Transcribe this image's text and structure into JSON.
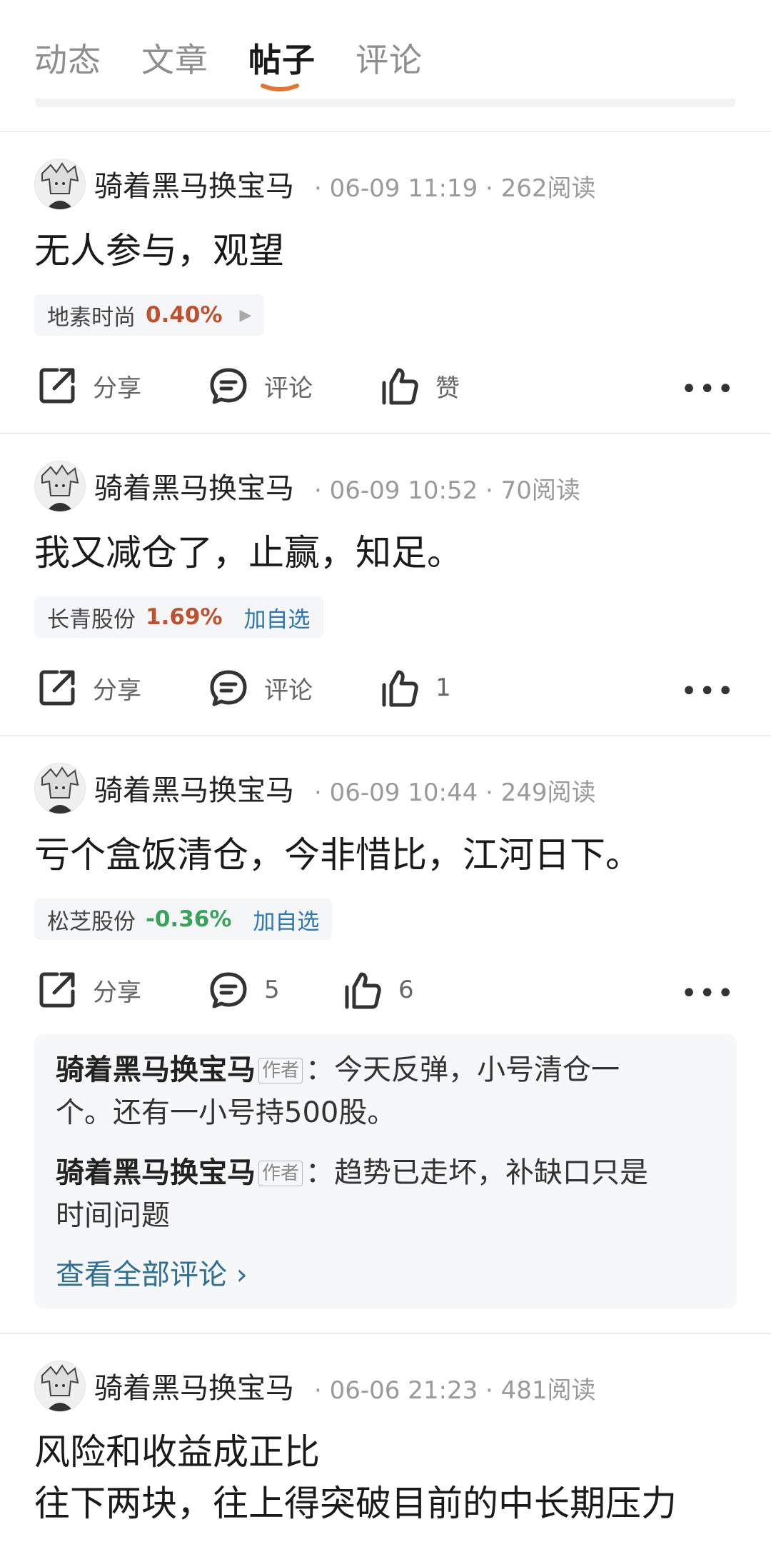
{
  "tabs": [
    "动态",
    "文章",
    "帖子",
    "评论"
  ],
  "active_tab": "帖子",
  "colors": {
    "up": "#c0512f",
    "down": "#3aa35b",
    "accent": "#e8742f",
    "link": "#2f77b3"
  },
  "posts": [
    {
      "author": "骑着黑马换宝马",
      "meta": "· 06-09 11:19 · 262阅读",
      "content": "无人参与，观望",
      "stock": {
        "name": "地素时尚",
        "pct": "0.40%",
        "action": ""
      },
      "share": "分享",
      "comment": "评论",
      "like": "赞"
    },
    {
      "author": "骑着黑马换宝马",
      "meta": "· 06-09 10:52 · 70阅读",
      "content": "我又减仓了，止赢，知足。",
      "stock": {
        "name": "长青股份",
        "pct": "1.69%",
        "action": "加自选"
      },
      "share": "分享",
      "comment": "评论",
      "like": "1"
    },
    {
      "author": "骑着黑马换宝马",
      "meta": "· 06-09 10:44 · 249阅读",
      "content": "亏个盒饭清仓，今非惜比，江河日下。",
      "stock": {
        "name": "松芝股份",
        "pct": "-0.36%",
        "action": "加自选"
      },
      "share": "分享",
      "comment": "5",
      "like": "6",
      "comments": [
        {
          "author": "骑着黑马换宝马",
          "tag": "作者",
          "text1": "：今天反弹，小号清仓一",
          "text2": "个。还有一小号持500股。"
        },
        {
          "author": "骑着黑马换宝马",
          "tag": "作者",
          "text1": "：趋势已走坏，补缺口只是",
          "text2": "时间问题"
        }
      ],
      "view_all": "查看全部评论 ›"
    },
    {
      "author": "骑着黑马换宝马",
      "meta": "· 06-06 21:23 · 481阅读",
      "content_line1": "风险和收益成正比",
      "content_line2": "往下两块，往上得突破目前的中长期压力"
    }
  ]
}
